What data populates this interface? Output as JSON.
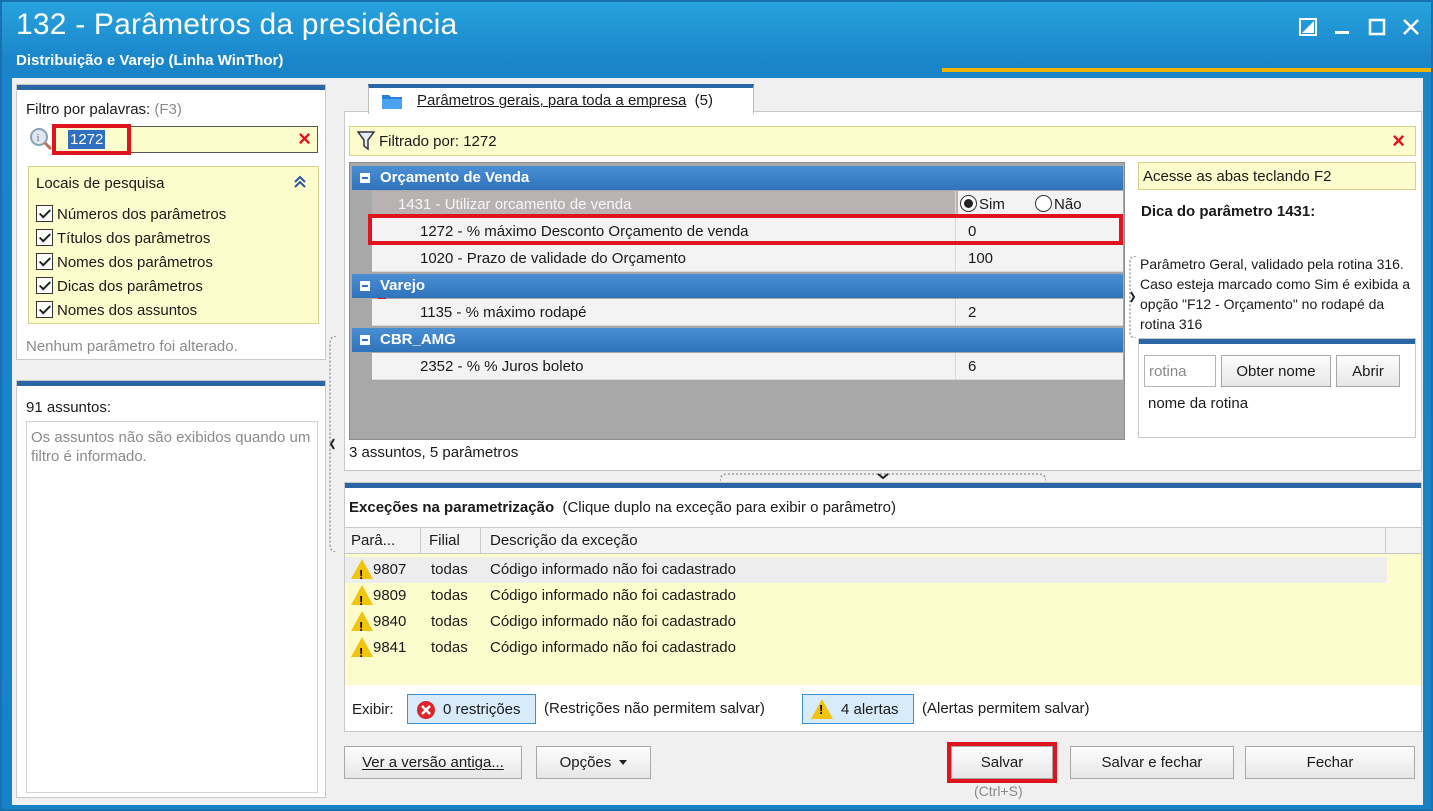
{
  "window": {
    "title": "132 - Parâmetros da presidência",
    "subtitle": "Distribuição e Varejo (Linha WinThor)"
  },
  "filter": {
    "label": "Filtro por palavras:",
    "shortcut": "(F3)",
    "value": "1272",
    "clear_glyph": "×"
  },
  "search_locations": {
    "title": "Locais de pesquisa",
    "items": [
      {
        "label": "Números dos parâmetros",
        "checked": true
      },
      {
        "label": "Títulos dos parâmetros",
        "checked": true
      },
      {
        "label": "Nomes dos parâmetros",
        "checked": true
      },
      {
        "label": "Dicas dos parâmetros",
        "checked": true
      },
      {
        "label": "Nomes dos assuntos",
        "checked": true
      }
    ],
    "status": "Nenhum parâmetro foi alterado."
  },
  "subjects": {
    "count_label": "91 assuntos:",
    "message": "Os assuntos não são exibidos quando um filtro é informado."
  },
  "tab": {
    "label": "Parâmetros gerais, para toda a empresa",
    "count": "(5)"
  },
  "filtered": {
    "label": "Filtrado por: 1272",
    "close_glyph": "×"
  },
  "groups": [
    {
      "name": "Orçamento  de Venda",
      "rows": [
        {
          "label": "1431 - Utilizar orcamento de venda",
          "value": "",
          "radio": true
        },
        {
          "label": "1272 - % máximo Desconto Orçamento de venda",
          "value": "0"
        },
        {
          "label": "1020 - Prazo de validade do Orçamento",
          "value": "100"
        }
      ]
    },
    {
      "name": "Varejo",
      "rows": [
        {
          "label": "1135 - % máximo rodapé",
          "value": "2"
        }
      ]
    },
    {
      "name": "CBR_AMG",
      "rows": [
        {
          "label": "2352 - % % Juros boleto",
          "value": "6"
        }
      ]
    }
  ],
  "radio": {
    "yes": "Sim",
    "no": "Não",
    "selected": "Sim"
  },
  "grid_footer": "3 assuntos, 5 parâmetros",
  "hint": {
    "access_tip": "Acesse as abas teclando F2",
    "title": "Dica do parâmetro 1431:",
    "text": "Parâmetro Geral, validado pela rotina 316. Caso esteja marcado como Sim é exibida a opção \"F12 - Orçamento\" no rodapé da rotina 316",
    "routine_placeholder": "rotina",
    "get_name_button": "Obter nome",
    "open_button": "Abrir",
    "routine_name": "nome da rotina"
  },
  "exceptions": {
    "title": "Exceções na parametrização",
    "subtitle": "(Clique duplo na exceção para exibir o parâmetro)",
    "columns": [
      "Parâ...",
      "Filial",
      "Descrição da exceção"
    ],
    "rows": [
      {
        "param": "9807",
        "branch": "todas",
        "description": "Código informado não foi cadastrado"
      },
      {
        "param": "9809",
        "branch": "todas",
        "description": "Código informado não foi cadastrado"
      },
      {
        "param": "9840",
        "branch": "todas",
        "description": "Código informado não foi cadastrado"
      },
      {
        "param": "9841",
        "branch": "todas",
        "description": "Código informado não foi cadastrado"
      }
    ],
    "show_label": "Exibir:",
    "restrictions_button": "0 restrições",
    "restrictions_note": "(Restrições não permitem salvar)",
    "alerts_button": "4 alertas",
    "alerts_note": "(Alertas permitem salvar)"
  },
  "footer": {
    "old_version": "Ver a versão antiga...",
    "options": "Opções",
    "save": "Salvar",
    "save_shortcut": "(Ctrl+S)",
    "save_close": "Salvar e fechar",
    "close": "Fechar"
  }
}
